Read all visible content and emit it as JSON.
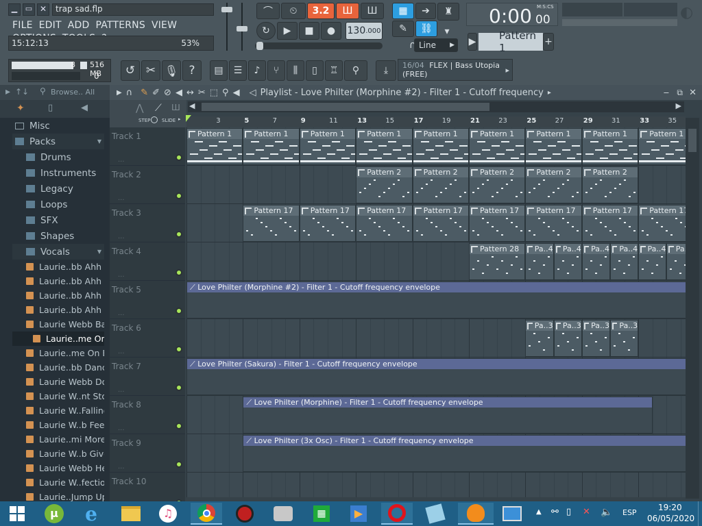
{
  "app": {
    "file_name": "trap sad.flp",
    "time_of_day": "15:12:13",
    "cpu": "53%",
    "memory": "516 MB",
    "voices": "8",
    "voices2": "0",
    "menu": [
      "FILE",
      "EDIT",
      "ADD",
      "PATTERNS",
      "VIEW",
      "OPTIONS",
      "TOOLS",
      "?"
    ]
  },
  "transport": {
    "tempo": "130",
    "tempo_frac": ".000",
    "time": "0:00",
    "time_small": "00",
    "time_label": "M:S:CS",
    "pattern": "Pattern 1",
    "snap": "Line",
    "wait_label": "3.2",
    "hint_count": "16/04",
    "hint_text": "FLEX | Bass Utopia",
    "hint_sub": "(FREE)"
  },
  "browser": {
    "header": "Browse.. All",
    "items": [
      {
        "label": "Misc",
        "kind": "folder"
      },
      {
        "label": "Packs",
        "kind": "pack"
      },
      {
        "label": "Drums",
        "kind": "sub"
      },
      {
        "label": "Instruments",
        "kind": "sub"
      },
      {
        "label": "Legacy",
        "kind": "sub"
      },
      {
        "label": "Loops",
        "kind": "sub"
      },
      {
        "label": "SFX",
        "kind": "sub"
      },
      {
        "label": "Shapes",
        "kind": "sub"
      },
      {
        "label": "Vocals",
        "kind": "sub"
      },
      {
        "label": "Laurie..bb Ahh A",
        "kind": "sample"
      },
      {
        "label": "Laurie..bb Ahh B",
        "kind": "sample"
      },
      {
        "label": "Laurie..bb Ahh C",
        "kind": "sample"
      },
      {
        "label": "Laurie..bb Ahh D",
        "kind": "sample"
      },
      {
        "label": "Laurie Webb Baby",
        "kind": "sample"
      },
      {
        "label": "Laurie..me On A",
        "kind": "sample",
        "selected": true
      },
      {
        "label": "Laurie..me On B",
        "kind": "sample"
      },
      {
        "label": "Laurie..bb Dance",
        "kind": "sample"
      },
      {
        "label": "Laurie Webb Do It",
        "kind": "sample"
      },
      {
        "label": "Laurie W..nt Stop",
        "kind": "sample"
      },
      {
        "label": "Laurie W..Falling",
        "kind": "sample"
      },
      {
        "label": "Laurie W..b Feel It",
        "kind": "sample"
      },
      {
        "label": "Laurie..mi More",
        "kind": "sample"
      },
      {
        "label": "Laurie W..b Give It",
        "kind": "sample"
      },
      {
        "label": "Laurie Webb Hey",
        "kind": "sample"
      },
      {
        "label": "Laurie W..fectious",
        "kind": "sample"
      },
      {
        "label": "Laurie..Jump Up",
        "kind": "sample"
      }
    ]
  },
  "playlist": {
    "title": "Playlist - Love Philter (Morphine #2) - Filter 1 - Cutoff frequency",
    "step_label": "STEP",
    "slide_label": "SLIDE",
    "ruler": [
      "3",
      "5",
      "7",
      "9",
      "11",
      "13",
      "15",
      "17",
      "19",
      "21",
      "23",
      "25",
      "27",
      "29",
      "31",
      "33",
      "35"
    ],
    "tracks": [
      "Track 1",
      "Track 2",
      "Track 3",
      "Track 4",
      "Track 5",
      "Track 6",
      "Track 7",
      "Track 8",
      "Track 9",
      "Track 10"
    ],
    "clips": {
      "p1": "Pattern 1",
      "p2": "Pattern 2",
      "p17": "Pattern 17",
      "p28": "Pattern 28",
      "pa4": "Pa..4",
      "pa3": "Pa..3"
    },
    "envelopes": {
      "e5": "Love Philter (Morphine #2) - Filter 1 - Cutoff frequency envelope",
      "e7": "Love Philter (Sakura) - Filter 1 - Cutoff frequency envelope",
      "e8": "Love Philter (Morphine) - Filter 1 - Cutoff frequency envelope",
      "e9": "Love Philter (3x Osc) - Filter 1 - Cutoff frequency envelope"
    }
  },
  "taskbar": {
    "lang": "ESP",
    "clock": "19:20",
    "date": "06/05/2020"
  },
  "colors": {
    "accent_orange": "#e8643c",
    "led_green": "#a8e65a",
    "blue_button": "#2d9ee0"
  }
}
